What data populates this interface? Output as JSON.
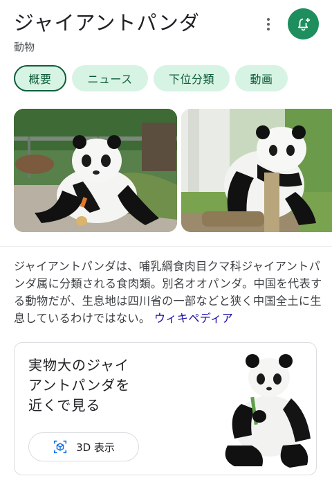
{
  "header": {
    "title": "ジャイアントパンダ",
    "subtitle": "動物"
  },
  "colors": {
    "accent": "#1e8e5e",
    "chip_bg": "#d7f3e3",
    "chip_text": "#0d5d3a",
    "link": "#1a0dab"
  },
  "chips": [
    {
      "label": "概要",
      "selected": true
    },
    {
      "label": "ニュース",
      "selected": false
    },
    {
      "label": "下位分類",
      "selected": false
    },
    {
      "label": "動画",
      "selected": false
    }
  ],
  "description": {
    "text": "ジャイアントパンダは、哺乳綱食肉目クマ科ジャイアントパンダ属に分類される食肉類。別名オオパンダ。中国を代表する動物だが、生息地は四川省の一部などと狭く中国全土に生息しているわけではない。",
    "source_link": "ウィキペディア"
  },
  "ar_card": {
    "line1": "実物大のジャイ",
    "line2": "アントパンダを",
    "line3": "近くで見る",
    "button_label": "3D 表示"
  },
  "icons": {
    "more": "more-vert-icon",
    "bell": "add-alert-icon",
    "view3d": "3d-view-icon"
  }
}
